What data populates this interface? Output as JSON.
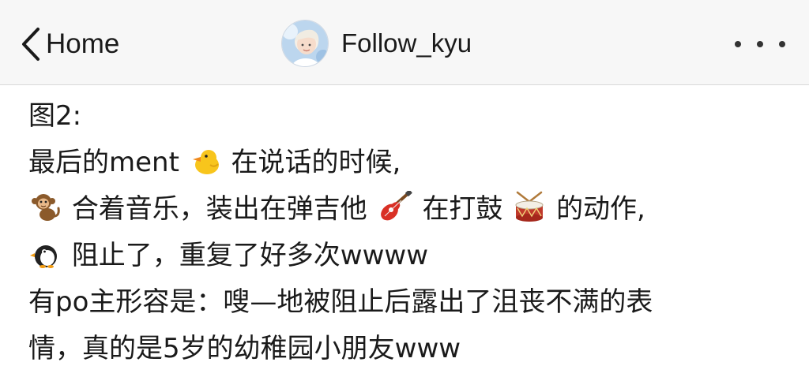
{
  "nav": {
    "back_label": "Home",
    "title": "Follow_kyu",
    "avatar_icon": "profile-avatar",
    "more_icon": "more-dots-icon"
  },
  "post": {
    "line1": "图2:",
    "line2_a": "最后的ment",
    "line2_b": "在说话的时候,",
    "line3_a": "合着音乐，装出在弹吉他",
    "line3_b": "在打鼓",
    "line3_c": "的动作,",
    "line4_a": "阻止了，重复了好多次wwww",
    "line5": "有po主形容是：嗖—地被阻止后露出了沮丧不满的表",
    "line6": "情，真的是5岁的幼稚园小朋友www",
    "emojis": [
      "chick-emoji",
      "monkey-emoji",
      "guitar-emoji",
      "drum-emoji",
      "penguin-emoji"
    ]
  }
}
